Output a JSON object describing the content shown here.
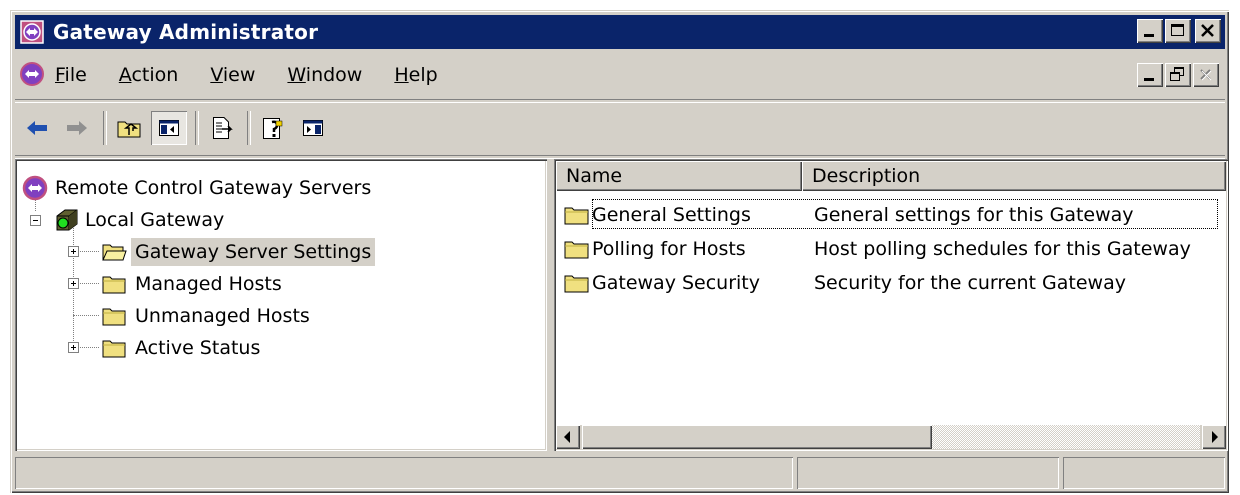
{
  "window": {
    "title": "Gateway Administrator",
    "title_bar_color": "#0a246a"
  },
  "menu": {
    "items": [
      {
        "label": "File",
        "accel": "F",
        "rest": "ile"
      },
      {
        "label": "Action",
        "accel": "A",
        "rest": "ction"
      },
      {
        "label": "View",
        "accel": "V",
        "rest": "iew"
      },
      {
        "label": "Window",
        "accel": "W",
        "rest": "indow"
      },
      {
        "label": "Help",
        "accel": "H",
        "rest": "elp"
      }
    ]
  },
  "toolbar": {
    "buttons": [
      "back-icon",
      "forward-icon",
      "up-level-icon",
      "show-hide-tree-icon",
      "export-list-icon",
      "help-icon",
      "show-hide-action-pane-icon"
    ]
  },
  "tree": {
    "root": "Remote Control Gateway Servers",
    "gateway": "Local Gateway",
    "items": [
      {
        "label": "Gateway Server Settings",
        "selected": true,
        "expandable": true
      },
      {
        "label": "Managed Hosts",
        "selected": false,
        "expandable": true
      },
      {
        "label": "Unmanaged Hosts",
        "selected": false,
        "expandable": false
      },
      {
        "label": "Active Status",
        "selected": false,
        "expandable": true
      }
    ]
  },
  "list": {
    "columns": [
      "Name",
      "Description"
    ],
    "rows": [
      {
        "name": "General Settings",
        "description": "General settings for this Gateway"
      },
      {
        "name": "Polling for Hosts",
        "description": "Host polling schedules for this Gateway"
      },
      {
        "name": "Gateway Security",
        "description": "Security for the current Gateway"
      }
    ]
  },
  "status": {
    "cells": [
      "",
      "",
      ""
    ]
  }
}
